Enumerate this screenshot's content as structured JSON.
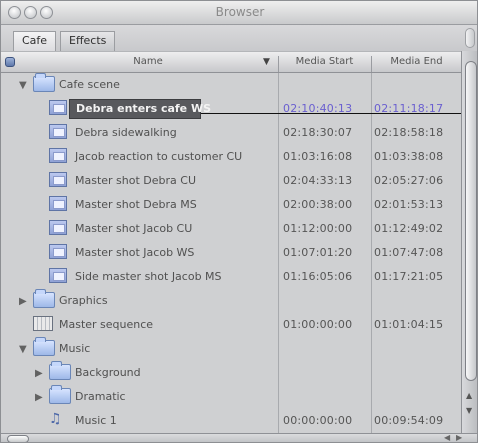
{
  "window": {
    "title": "Browser"
  },
  "tabs": [
    "Cafe",
    "Effects"
  ],
  "header": {
    "name": "Name",
    "media_start": "Media Start",
    "media_end": "Media End"
  },
  "rows": [
    {
      "name": "Cafe scene",
      "media_start": "",
      "media_end": "",
      "type": "folder",
      "expanded": true,
      "selected": false
    },
    {
      "name": "Debra enters cafe WS",
      "media_start": "02:10:40:13",
      "media_end": "02:11:18:17",
      "type": "clip",
      "expanded": false,
      "selected": true
    },
    {
      "name": "Debra sidewalking",
      "media_start": "02:18:30:07",
      "media_end": "02:18:58:18",
      "type": "clip",
      "expanded": false,
      "selected": false
    },
    {
      "name": "Jacob reaction to customer CU",
      "media_start": "01:03:16:08",
      "media_end": "01:03:38:08",
      "type": "clip",
      "expanded": false,
      "selected": false
    },
    {
      "name": "Master shot Debra CU",
      "media_start": "02:04:33:13",
      "media_end": "02:05:27:06",
      "type": "clip",
      "expanded": false,
      "selected": false
    },
    {
      "name": "Master shot Debra MS",
      "media_start": "02:00:38:00",
      "media_end": "02:01:53:13",
      "type": "clip",
      "expanded": false,
      "selected": false
    },
    {
      "name": "Master shot Jacob CU",
      "media_start": "01:12:00:00",
      "media_end": "01:12:49:02",
      "type": "clip",
      "expanded": false,
      "selected": false
    },
    {
      "name": "Master shot Jacob WS",
      "media_start": "01:07:01:20",
      "media_end": "01:07:47:08",
      "type": "clip",
      "expanded": false,
      "selected": false
    },
    {
      "name": "Side master shot Jacob MS",
      "media_start": "01:16:05:06",
      "media_end": "01:17:21:05",
      "type": "clip",
      "expanded": false,
      "selected": false
    },
    {
      "name": "Graphics",
      "media_start": "",
      "media_end": "",
      "type": "folder",
      "expanded": false,
      "selected": false
    },
    {
      "name": "Master sequence",
      "media_start": "01:00:00:00",
      "media_end": "01:01:04:15",
      "type": "sequence",
      "expanded": false,
      "selected": false
    },
    {
      "name": "Music",
      "media_start": "",
      "media_end": "",
      "type": "folder",
      "expanded": true,
      "selected": false
    },
    {
      "name": "Background",
      "media_start": "",
      "media_end": "",
      "type": "folder",
      "expanded": false,
      "selected": false
    },
    {
      "name": "Dramatic",
      "media_start": "",
      "media_end": "",
      "type": "folder",
      "expanded": false,
      "selected": false
    },
    {
      "name": "Music 1",
      "media_start": "00:00:00:00",
      "media_end": "00:09:54:09",
      "type": "audio",
      "expanded": false,
      "selected": false
    }
  ]
}
